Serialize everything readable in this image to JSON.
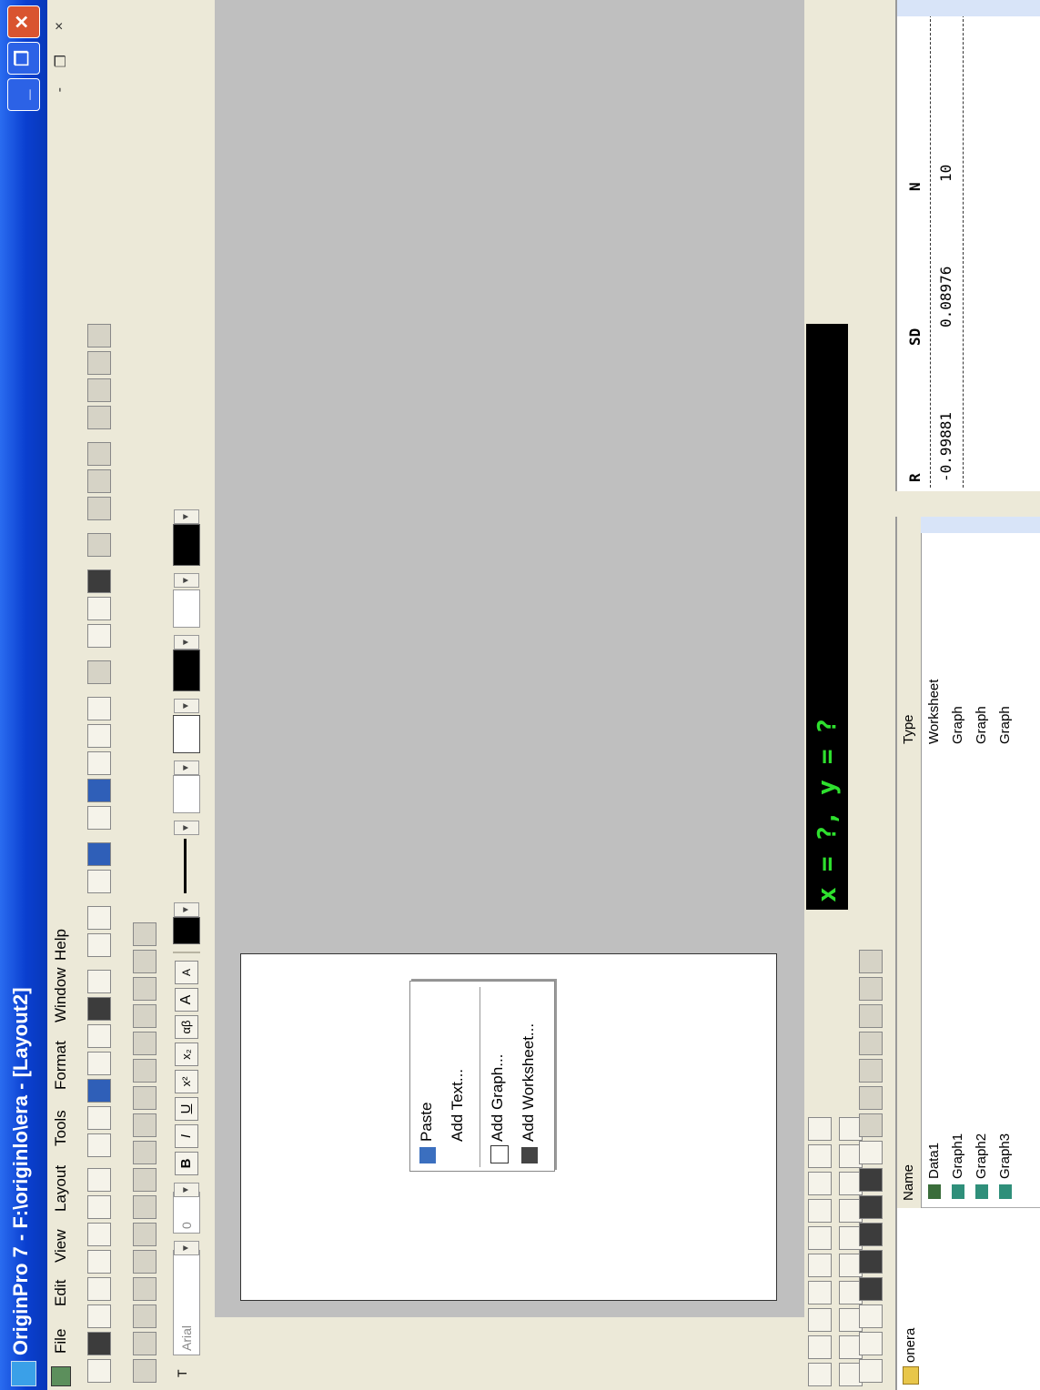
{
  "window": {
    "title": "OriginPro 7 - F:\\originlo\\era - [Layout2]",
    "buttons": {
      "minimize": "_",
      "restore": "❐",
      "close": "✕"
    }
  },
  "menu": {
    "items": [
      "File",
      "Edit",
      "View",
      "Layout",
      "Tools",
      "Format",
      "Window",
      "Help"
    ],
    "mdi_controls": {
      "minimize": "-",
      "restore": "❐",
      "close": "×"
    }
  },
  "format_toolbar": {
    "font_name": "Arial",
    "font_size": "0",
    "bold": "B",
    "italic": "I",
    "underline": "U",
    "superscript": "x²",
    "subscript": "x₂",
    "greek": "αβ",
    "increase_font": "A",
    "decrease_font": "A"
  },
  "context_menu": {
    "items": [
      "Paste",
      "Add Text...",
      "Add Graph...",
      "Add Worksheet..."
    ]
  },
  "readout": {
    "text": "x = ?, y = ?"
  },
  "project_explorer": {
    "folder": "onera",
    "columns": [
      "Name",
      "Type"
    ],
    "rows": [
      {
        "name": "Data1",
        "type": "Worksheet",
        "icon": "worksheet-icon"
      },
      {
        "name": "Graph1",
        "type": "Graph",
        "icon": "graph-icon"
      },
      {
        "name": "Graph2",
        "type": "Graph",
        "icon": "graph-icon"
      },
      {
        "name": "Graph3",
        "type": "Graph",
        "icon": "graph-icon"
      }
    ]
  },
  "results": {
    "columns": [
      "R",
      "SD",
      "N"
    ],
    "values": [
      "-0.99881",
      "0.08976",
      "10"
    ]
  }
}
